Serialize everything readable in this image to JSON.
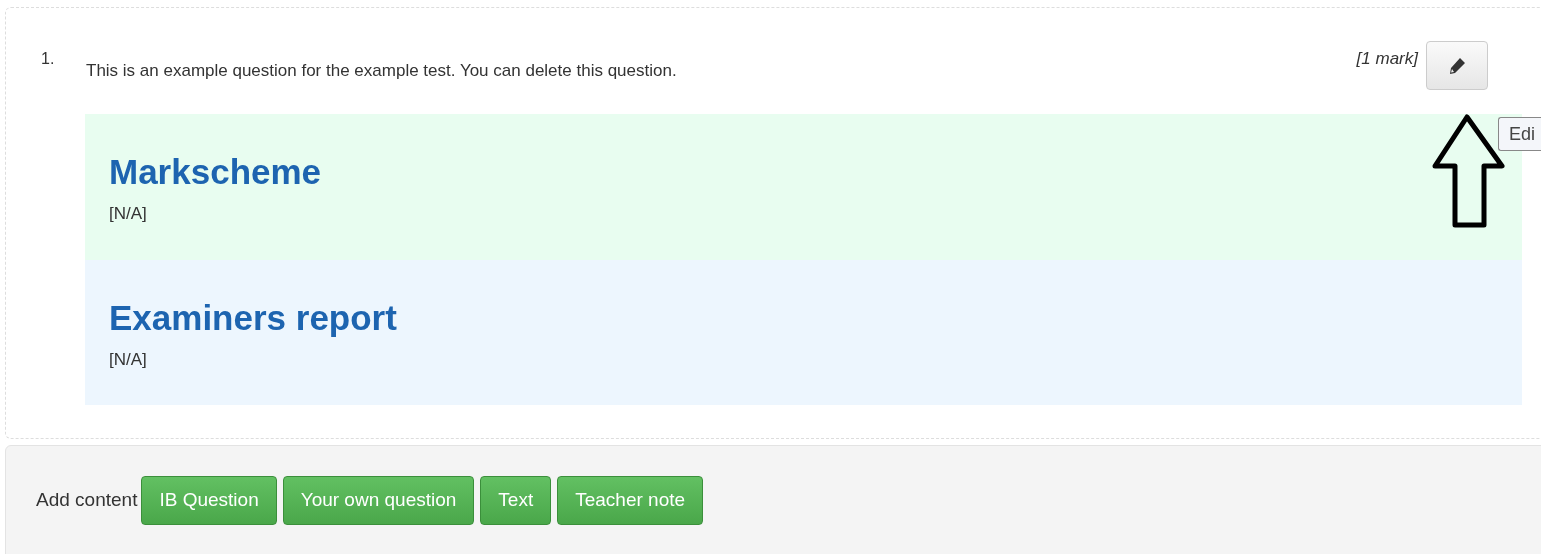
{
  "question": {
    "number": "1.",
    "text": "This is an example question for the example test. You can delete this question.",
    "marks": "[1 mark]",
    "edit_tooltip": "Edi",
    "sections": [
      {
        "kind": "markscheme",
        "title": "Markscheme",
        "body": "[N/A]"
      },
      {
        "kind": "report",
        "title": "Examiners report",
        "body": "[N/A]"
      }
    ]
  },
  "add_content": {
    "label": "Add content",
    "buttons": [
      "IB Question",
      "Your own question",
      "Text",
      "Teacher note"
    ]
  }
}
